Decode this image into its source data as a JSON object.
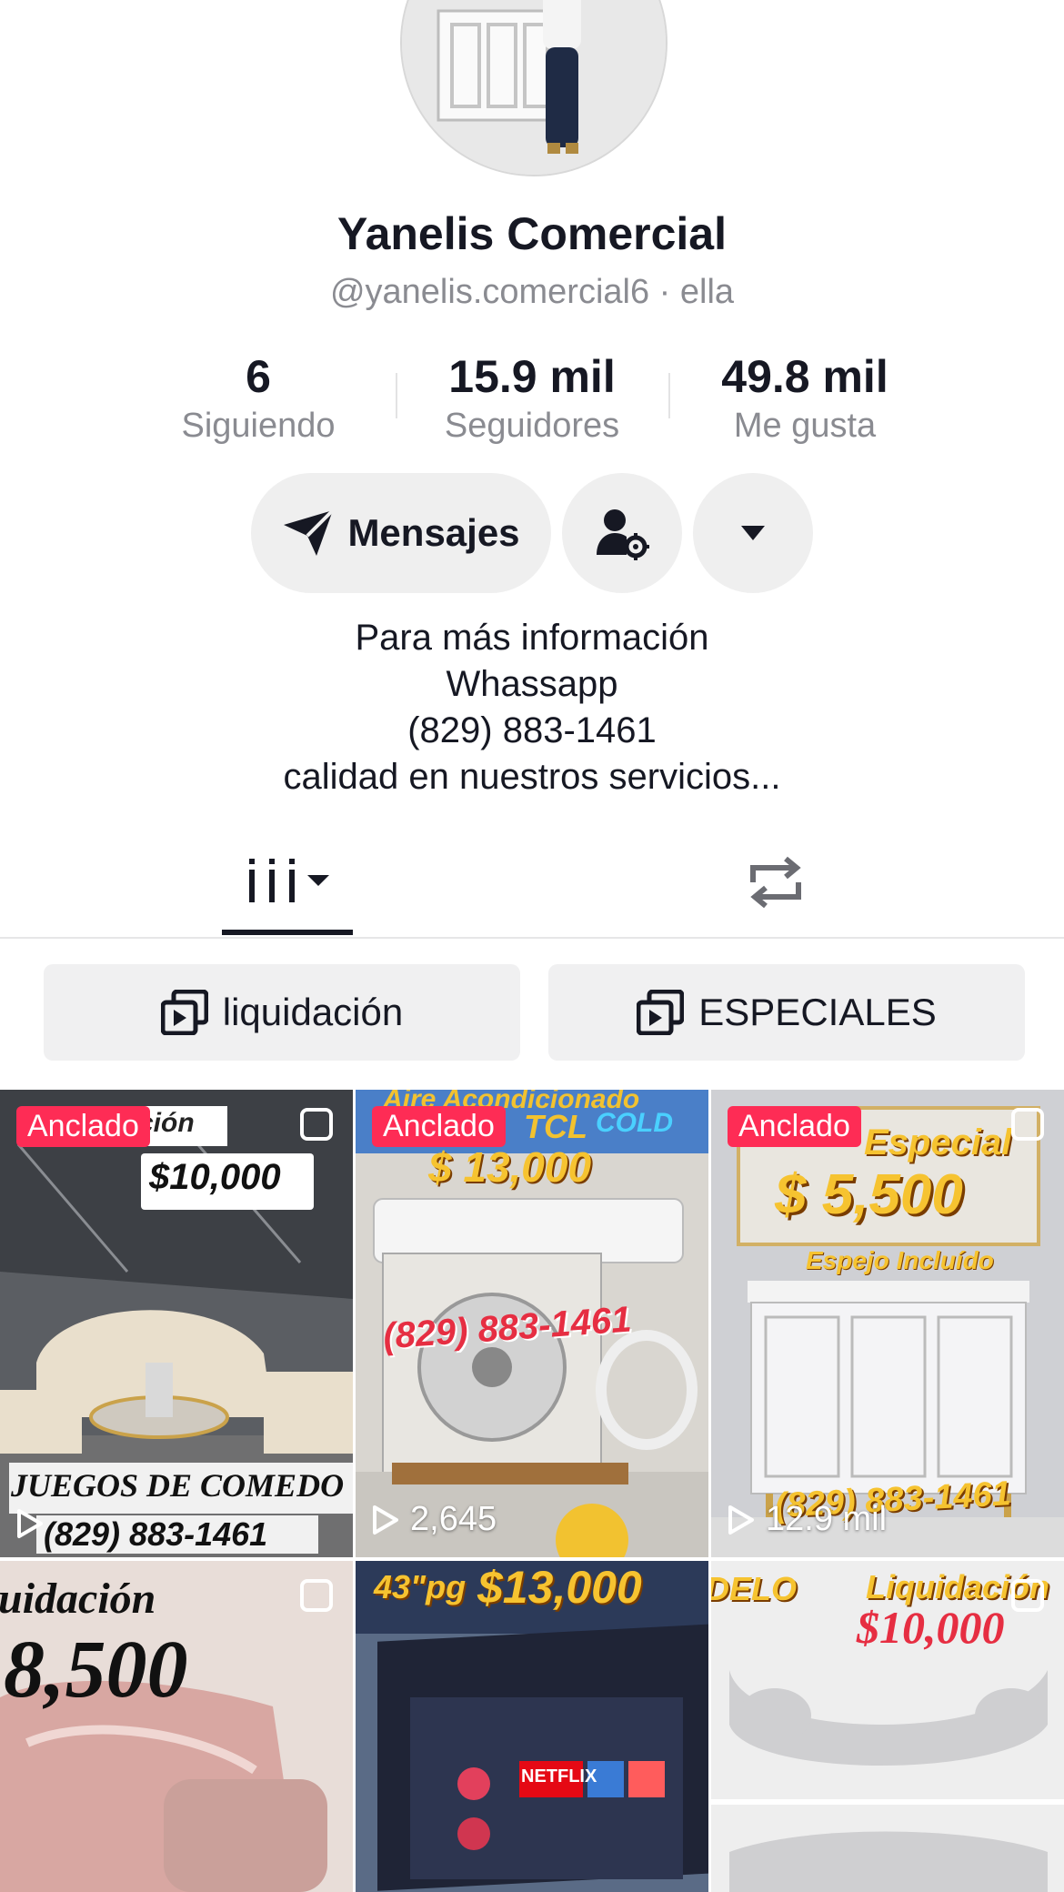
{
  "profile": {
    "name": "Yanelis Comercial",
    "handle": "@yanelis.comercial6",
    "pronoun": "· ella"
  },
  "stats": [
    {
      "value": "6",
      "label": "Siguiendo"
    },
    {
      "value": "15.9 mil",
      "label": "Seguidores"
    },
    {
      "value": "49.8 mil",
      "label": "Me gusta"
    }
  ],
  "actions": {
    "message_label": "Mensajes",
    "icons": [
      "send-icon",
      "user-settings-icon",
      "caret-down-icon"
    ]
  },
  "bio": {
    "lines": [
      "Para más información",
      "Whassapp",
      "(829) 883-1461",
      "calidad en nuestros servicios..."
    ]
  },
  "tabs": {
    "icons": [
      "grid-icon",
      "repost-icon"
    ],
    "active": "videos"
  },
  "playlists": [
    {
      "label": "liquidación"
    },
    {
      "label": "ESPECIALES"
    }
  ],
  "videos": [
    {
      "pinned": "Anclado",
      "views": "",
      "overlay_texts": [
        "ción",
        "$10,000",
        "JUEGOS DE COMEDO",
        "(829) 883-1461"
      ]
    },
    {
      "pinned": "Anclado",
      "views": "2,645",
      "overlay_texts": [
        "Aire Acondicionado",
        "TCL",
        "COLD",
        "$ 13,000",
        "(829) 883-1461"
      ]
    },
    {
      "pinned": "Anclado",
      "views": "12.9 mil",
      "overlay_texts": [
        "Especial",
        "$ 5,500",
        "Espejo Incluído",
        "(829) 883-1461"
      ]
    },
    {
      "pinned": "",
      "views": "",
      "overlay_texts": [
        "uidación",
        "8,500"
      ]
    },
    {
      "pinned": "",
      "views": "",
      "overlay_texts": [
        "43\"pg",
        "$13,000",
        "NETFLIX"
      ]
    },
    {
      "pinned": "",
      "views": "",
      "overlay_texts": [
        "DELO",
        "Liquidación",
        "$10,000"
      ]
    }
  ],
  "colors": {
    "accent": "#fe2c55",
    "text": "#161823",
    "muted": "#8a8b91",
    "button_bg": "#efefef"
  }
}
